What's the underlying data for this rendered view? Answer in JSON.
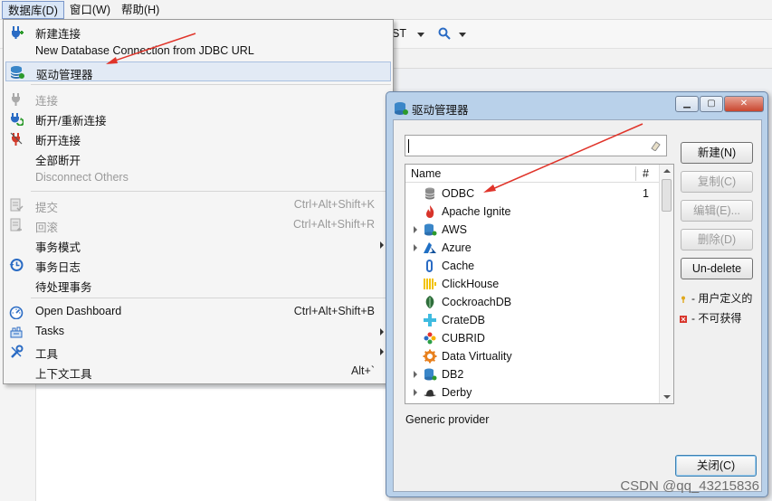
{
  "menubar": {
    "items": [
      "数据库(D)",
      "窗口(W)",
      "帮助(H)"
    ]
  },
  "toolbar": {
    "fragment": "ST"
  },
  "database_menu": {
    "items": [
      {
        "label": "新建连接",
        "shortcut": "",
        "icon": "new-connection-icon",
        "disabled": false
      },
      {
        "label": "New Database Connection from JDBC URL",
        "shortcut": "",
        "icon": "",
        "disabled": false
      },
      {
        "label": "驱动管理器",
        "shortcut": "",
        "icon": "driver-manager-icon",
        "disabled": false,
        "highlighted": true
      },
      {
        "label": "连接",
        "shortcut": "",
        "icon": "plug-icon",
        "disabled": true
      },
      {
        "label": "断开/重新连接",
        "shortcut": "",
        "icon": "reconnect-icon",
        "disabled": false
      },
      {
        "label": "断开连接",
        "shortcut": "",
        "icon": "disconnect-icon",
        "disabled": false
      },
      {
        "label": "全部断开",
        "shortcut": "",
        "icon": "",
        "disabled": false
      },
      {
        "label": "Disconnect Others",
        "shortcut": "",
        "icon": "",
        "disabled": true
      },
      {
        "label": "提交",
        "shortcut": "Ctrl+Alt+Shift+K",
        "icon": "commit-icon",
        "disabled": true
      },
      {
        "label": "回滚",
        "shortcut": "Ctrl+Alt+Shift+R",
        "icon": "rollback-icon",
        "disabled": true
      },
      {
        "label": "事务模式",
        "shortcut": "",
        "icon": "",
        "disabled": false,
        "submenu": true
      },
      {
        "label": "事务日志",
        "shortcut": "",
        "icon": "history-icon",
        "disabled": false
      },
      {
        "label": "待处理事务",
        "shortcut": "",
        "icon": "",
        "disabled": false
      },
      {
        "label": "Open Dashboard",
        "shortcut": "Ctrl+Alt+Shift+B",
        "icon": "dashboard-icon",
        "disabled": false
      },
      {
        "label": "Tasks",
        "shortcut": "",
        "icon": "tasks-icon",
        "disabled": false,
        "submenu": true
      },
      {
        "label": "工具",
        "shortcut": "",
        "icon": "tools-icon",
        "disabled": false,
        "submenu": true
      },
      {
        "label": "上下文工具",
        "shortcut": "Alt+`",
        "icon": "",
        "disabled": false
      }
    ]
  },
  "driver_dialog": {
    "title": "驱动管理器",
    "search": {
      "value": "",
      "placeholder": ""
    },
    "columns": [
      "Name",
      "#"
    ],
    "drivers": [
      {
        "name": "ODBC",
        "count": "1",
        "expandable": false,
        "icon": "database-icon"
      },
      {
        "name": "Apache Ignite",
        "count": "",
        "expandable": false,
        "icon": "ignite-flame-icon"
      },
      {
        "name": "AWS",
        "count": "",
        "expandable": true,
        "icon": "database-icon"
      },
      {
        "name": "Azure",
        "count": "",
        "expandable": true,
        "icon": "azure-icon"
      },
      {
        "name": "Cache",
        "count": "",
        "expandable": false,
        "icon": "cache-icon"
      },
      {
        "name": "ClickHouse",
        "count": "",
        "expandable": false,
        "icon": "clickhouse-icon"
      },
      {
        "name": "CockroachDB",
        "count": "",
        "expandable": false,
        "icon": "cockroach-icon"
      },
      {
        "name": "CrateDB",
        "count": "",
        "expandable": false,
        "icon": "cratedb-icon"
      },
      {
        "name": "CUBRID",
        "count": "",
        "expandable": false,
        "icon": "cubrid-icon"
      },
      {
        "name": "Data Virtuality",
        "count": "",
        "expandable": false,
        "icon": "gear-icon"
      },
      {
        "name": "DB2",
        "count": "",
        "expandable": true,
        "icon": "database-icon"
      },
      {
        "name": "Derby",
        "count": "",
        "expandable": true,
        "icon": "derby-hat-icon"
      }
    ],
    "provider_text": "Generic provider",
    "buttons": {
      "new": "新建(N)",
      "copy": "复制(C)",
      "edit": "编辑(E)...",
      "delete": "删除(D)",
      "undelete": "Un-delete",
      "close": "关闭(C)"
    },
    "legend": {
      "user_defined": "- 用户定义的",
      "unavailable": "- 不可获得"
    }
  },
  "watermark": "CSDN @qq_43215836",
  "colors": {
    "annotation_arrow": "#e0342a",
    "dialog_frame": "#b9d1ea",
    "menu_highlight": "#e2eaf5"
  }
}
